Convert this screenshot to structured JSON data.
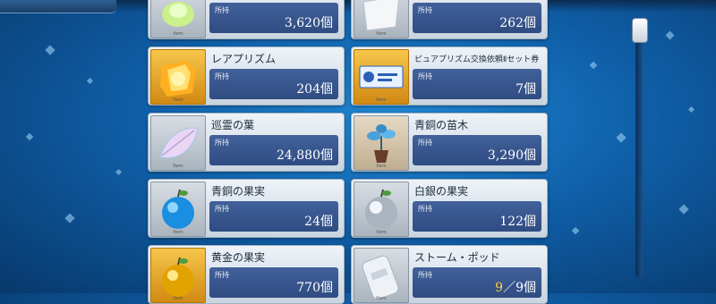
{
  "owned_label": "所持",
  "thumb_tag": "Item",
  "items": [
    {
      "name": "",
      "count": "3,620個",
      "icon": "green-crystal-icon"
    },
    {
      "name": "",
      "count": "262個",
      "icon": "white-cloth-icon"
    },
    {
      "name": "レアプリズム",
      "count": "204個",
      "icon": "rare-prism-icon"
    },
    {
      "name": "ピュアプリズム交換依頼Ⅱセット券",
      "count": "7個",
      "icon": "ticket-icon"
    },
    {
      "name": "巡霊の葉",
      "count": "24,880個",
      "icon": "spirit-leaf-icon"
    },
    {
      "name": "青銅の苗木",
      "count": "3,290個",
      "icon": "bronze-sapling-icon"
    },
    {
      "name": "青銅の果実",
      "count": "24個",
      "icon": "blue-apple-icon"
    },
    {
      "name": "白銀の果実",
      "count": "122個",
      "icon": "silver-apple-icon"
    },
    {
      "name": "黄金の果実",
      "count": "770個",
      "icon": "gold-apple-icon"
    },
    {
      "name": "ストーム・ポッド",
      "count_num": "9",
      "count_suffix": "／9個",
      "icon": "storm-pod-icon"
    }
  ],
  "colors": {
    "panel": "#3a5a90",
    "accent_warn": "#ffd23a"
  }
}
